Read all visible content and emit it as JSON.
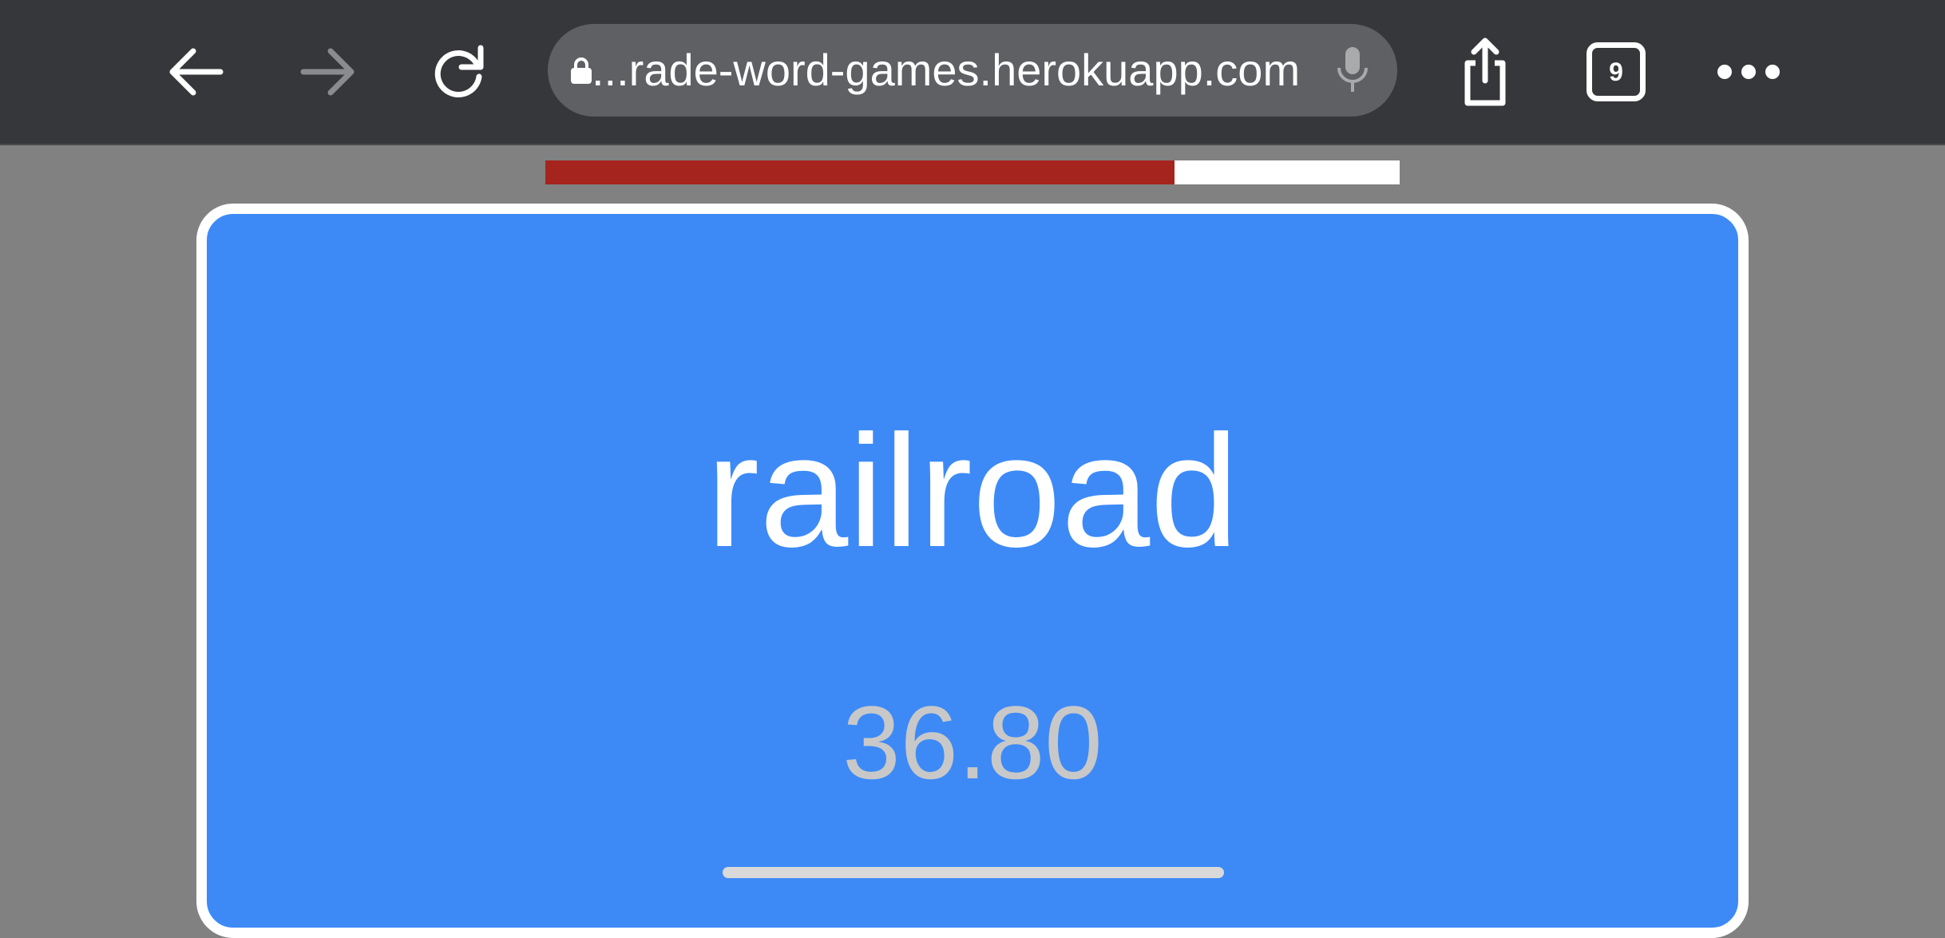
{
  "browser": {
    "url_text": "...rade-word-games.herokuapp.com",
    "tab_count": "9",
    "icons": {
      "back": "arrow-left-icon",
      "forward": "arrow-right-icon",
      "reload": "reload-icon",
      "lock": "lock-icon",
      "mic": "microphone-icon",
      "share": "share-icon",
      "tabs": "tabs-icon",
      "more": "more-icon"
    }
  },
  "game": {
    "word": "railroad",
    "score": "36.80",
    "timer_progress": 0.736,
    "colors": {
      "card": "#3d8af7",
      "timer_fill": "#a5241d",
      "background": "#818181"
    }
  }
}
